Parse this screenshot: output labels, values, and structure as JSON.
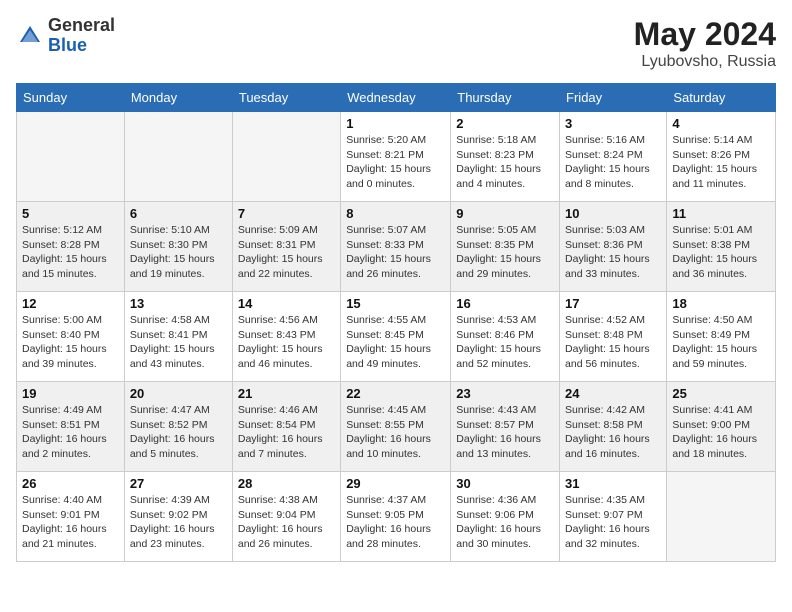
{
  "header": {
    "logo_general": "General",
    "logo_blue": "Blue",
    "month_year": "May 2024",
    "location": "Lyubovsho, Russia"
  },
  "days_of_week": [
    "Sunday",
    "Monday",
    "Tuesday",
    "Wednesday",
    "Thursday",
    "Friday",
    "Saturday"
  ],
  "weeks": [
    [
      {
        "day": "",
        "info": ""
      },
      {
        "day": "",
        "info": ""
      },
      {
        "day": "",
        "info": ""
      },
      {
        "day": "1",
        "info": "Sunrise: 5:20 AM\nSunset: 8:21 PM\nDaylight: 15 hours\nand 0 minutes."
      },
      {
        "day": "2",
        "info": "Sunrise: 5:18 AM\nSunset: 8:23 PM\nDaylight: 15 hours\nand 4 minutes."
      },
      {
        "day": "3",
        "info": "Sunrise: 5:16 AM\nSunset: 8:24 PM\nDaylight: 15 hours\nand 8 minutes."
      },
      {
        "day": "4",
        "info": "Sunrise: 5:14 AM\nSunset: 8:26 PM\nDaylight: 15 hours\nand 11 minutes."
      }
    ],
    [
      {
        "day": "5",
        "info": "Sunrise: 5:12 AM\nSunset: 8:28 PM\nDaylight: 15 hours\nand 15 minutes."
      },
      {
        "day": "6",
        "info": "Sunrise: 5:10 AM\nSunset: 8:30 PM\nDaylight: 15 hours\nand 19 minutes."
      },
      {
        "day": "7",
        "info": "Sunrise: 5:09 AM\nSunset: 8:31 PM\nDaylight: 15 hours\nand 22 minutes."
      },
      {
        "day": "8",
        "info": "Sunrise: 5:07 AM\nSunset: 8:33 PM\nDaylight: 15 hours\nand 26 minutes."
      },
      {
        "day": "9",
        "info": "Sunrise: 5:05 AM\nSunset: 8:35 PM\nDaylight: 15 hours\nand 29 minutes."
      },
      {
        "day": "10",
        "info": "Sunrise: 5:03 AM\nSunset: 8:36 PM\nDaylight: 15 hours\nand 33 minutes."
      },
      {
        "day": "11",
        "info": "Sunrise: 5:01 AM\nSunset: 8:38 PM\nDaylight: 15 hours\nand 36 minutes."
      }
    ],
    [
      {
        "day": "12",
        "info": "Sunrise: 5:00 AM\nSunset: 8:40 PM\nDaylight: 15 hours\nand 39 minutes."
      },
      {
        "day": "13",
        "info": "Sunrise: 4:58 AM\nSunset: 8:41 PM\nDaylight: 15 hours\nand 43 minutes."
      },
      {
        "day": "14",
        "info": "Sunrise: 4:56 AM\nSunset: 8:43 PM\nDaylight: 15 hours\nand 46 minutes."
      },
      {
        "day": "15",
        "info": "Sunrise: 4:55 AM\nSunset: 8:45 PM\nDaylight: 15 hours\nand 49 minutes."
      },
      {
        "day": "16",
        "info": "Sunrise: 4:53 AM\nSunset: 8:46 PM\nDaylight: 15 hours\nand 52 minutes."
      },
      {
        "day": "17",
        "info": "Sunrise: 4:52 AM\nSunset: 8:48 PM\nDaylight: 15 hours\nand 56 minutes."
      },
      {
        "day": "18",
        "info": "Sunrise: 4:50 AM\nSunset: 8:49 PM\nDaylight: 15 hours\nand 59 minutes."
      }
    ],
    [
      {
        "day": "19",
        "info": "Sunrise: 4:49 AM\nSunset: 8:51 PM\nDaylight: 16 hours\nand 2 minutes."
      },
      {
        "day": "20",
        "info": "Sunrise: 4:47 AM\nSunset: 8:52 PM\nDaylight: 16 hours\nand 5 minutes."
      },
      {
        "day": "21",
        "info": "Sunrise: 4:46 AM\nSunset: 8:54 PM\nDaylight: 16 hours\nand 7 minutes."
      },
      {
        "day": "22",
        "info": "Sunrise: 4:45 AM\nSunset: 8:55 PM\nDaylight: 16 hours\nand 10 minutes."
      },
      {
        "day": "23",
        "info": "Sunrise: 4:43 AM\nSunset: 8:57 PM\nDaylight: 16 hours\nand 13 minutes."
      },
      {
        "day": "24",
        "info": "Sunrise: 4:42 AM\nSunset: 8:58 PM\nDaylight: 16 hours\nand 16 minutes."
      },
      {
        "day": "25",
        "info": "Sunrise: 4:41 AM\nSunset: 9:00 PM\nDaylight: 16 hours\nand 18 minutes."
      }
    ],
    [
      {
        "day": "26",
        "info": "Sunrise: 4:40 AM\nSunset: 9:01 PM\nDaylight: 16 hours\nand 21 minutes."
      },
      {
        "day": "27",
        "info": "Sunrise: 4:39 AM\nSunset: 9:02 PM\nDaylight: 16 hours\nand 23 minutes."
      },
      {
        "day": "28",
        "info": "Sunrise: 4:38 AM\nSunset: 9:04 PM\nDaylight: 16 hours\nand 26 minutes."
      },
      {
        "day": "29",
        "info": "Sunrise: 4:37 AM\nSunset: 9:05 PM\nDaylight: 16 hours\nand 28 minutes."
      },
      {
        "day": "30",
        "info": "Sunrise: 4:36 AM\nSunset: 9:06 PM\nDaylight: 16 hours\nand 30 minutes."
      },
      {
        "day": "31",
        "info": "Sunrise: 4:35 AM\nSunset: 9:07 PM\nDaylight: 16 hours\nand 32 minutes."
      },
      {
        "day": "",
        "info": ""
      }
    ]
  ]
}
